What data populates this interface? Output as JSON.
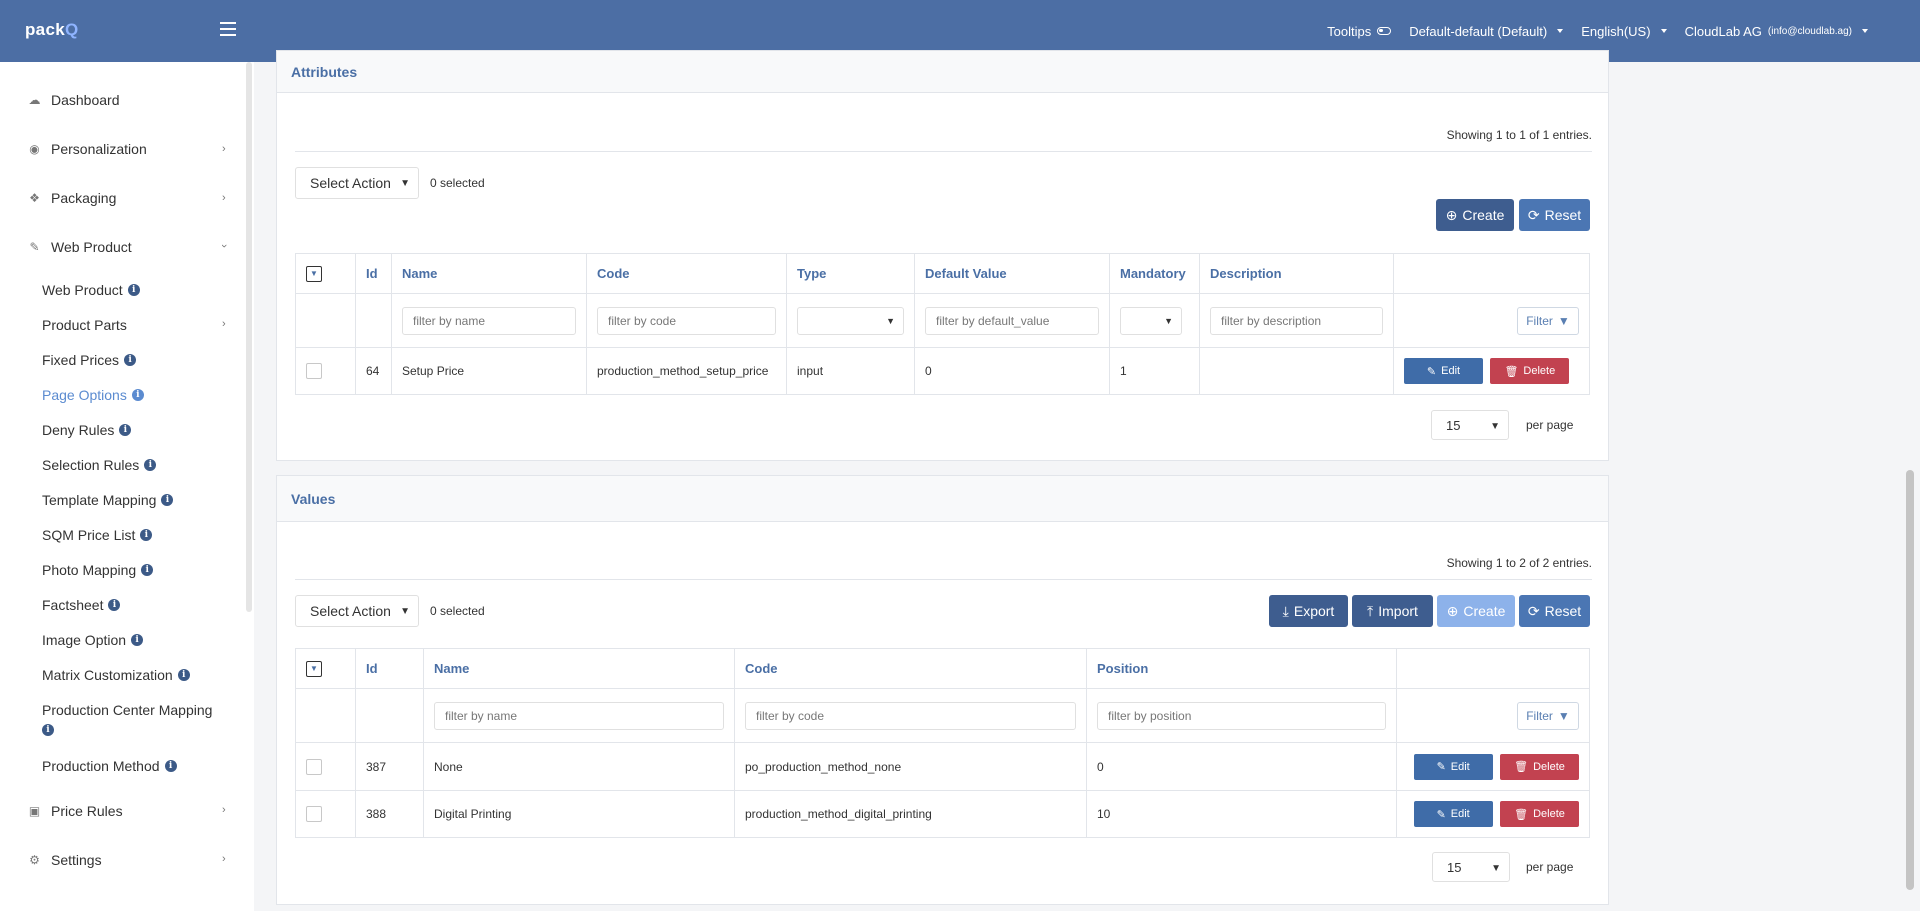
{
  "header": {
    "logo_prefix": "pack",
    "logo_suffix": "Q",
    "tooltips": "Tooltips",
    "store": "Default-default (Default)",
    "language": "English(US)",
    "account": "CloudLab AG",
    "account_email": "(info@cloudlab.ag)"
  },
  "sidebar": {
    "top_items": [
      {
        "label": "Dashboard",
        "icon": "cloud-icon"
      },
      {
        "label": "Personalization",
        "icon": "eye-icon"
      },
      {
        "label": "Packaging",
        "icon": "boxes-icon"
      },
      {
        "label": "Web Product",
        "icon": "magic-wand-icon"
      }
    ],
    "sub_items": [
      {
        "label": "Web Product"
      },
      {
        "label": "Product Parts"
      },
      {
        "label": "Fixed Prices"
      },
      {
        "label": "Page Options"
      },
      {
        "label": "Deny Rules"
      },
      {
        "label": "Selection Rules"
      },
      {
        "label": "Template Mapping"
      },
      {
        "label": "SQM Price List"
      },
      {
        "label": "Photo Mapping"
      },
      {
        "label": "Factsheet"
      },
      {
        "label": "Image Option"
      },
      {
        "label": "Matrix Customization"
      },
      {
        "label": "Production Center Mapping"
      },
      {
        "label": "Production Method"
      }
    ],
    "bottom_items": [
      {
        "label": "Price Rules",
        "icon": "money-icon"
      },
      {
        "label": "Settings",
        "icon": "gears-icon"
      }
    ]
  },
  "attributes": {
    "title": "Attributes",
    "showing": "Showing 1 to 1 of 1 entries.",
    "select_action": "Select Action",
    "selected": "0 selected",
    "create": "Create",
    "reset": "Reset",
    "columns": [
      "Id",
      "Name",
      "Code",
      "Type",
      "Default Value",
      "Mandatory",
      "Description"
    ],
    "filters": {
      "name": "filter by name",
      "code": "filter by code",
      "default_value": "filter by default_value",
      "description": "filter by description"
    },
    "filter_button": "Filter",
    "rows": [
      {
        "id": "64",
        "name": "Setup Price",
        "code": "production_method_setup_price",
        "type": "input",
        "default_value": "0",
        "mandatory": "1",
        "description": ""
      }
    ],
    "edit": "Edit",
    "delete": "Delete",
    "per_page_value": "15",
    "per_page_label": "per page"
  },
  "values": {
    "title": "Values",
    "showing": "Showing 1 to 2 of 2 entries.",
    "select_action": "Select Action",
    "selected": "0 selected",
    "export": "Export",
    "import": "Import",
    "create": "Create",
    "reset": "Reset",
    "columns": [
      "Id",
      "Name",
      "Code",
      "Position"
    ],
    "filters": {
      "name": "filter by name",
      "code": "filter by code",
      "position": "filter by position"
    },
    "filter_button": "Filter",
    "rows": [
      {
        "id": "387",
        "name": "None",
        "code": "po_production_method_none",
        "position": "0"
      },
      {
        "id": "388",
        "name": "Digital Printing",
        "code": "production_method_digital_printing",
        "position": "10"
      }
    ],
    "edit": "Edit",
    "delete": "Delete",
    "per_page_value": "15",
    "per_page_label": "per page"
  }
}
